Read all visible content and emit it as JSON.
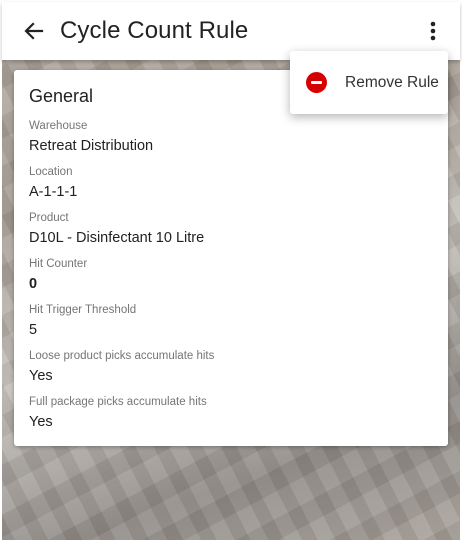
{
  "header": {
    "title": "Cycle Count Rule",
    "back_icon": "arrow-left-icon",
    "more_icon": "more-vertical-icon"
  },
  "menu": {
    "items": [
      {
        "label": "Remove Rule",
        "icon": "remove-circle-icon",
        "icon_color": "#d50000"
      }
    ]
  },
  "card": {
    "title": "General",
    "fields": [
      {
        "label": "Warehouse",
        "value": "Retreat Distribution"
      },
      {
        "label": "Location",
        "value": "A-1-1-1"
      },
      {
        "label": "Product",
        "value": "D10L - Disinfectant 10 Litre"
      },
      {
        "label": "Hit Counter",
        "value": "0"
      },
      {
        "label": "Hit Trigger Threshold",
        "value": "5"
      },
      {
        "label": "Loose product picks accumulate hits",
        "value": "Yes"
      },
      {
        "label": "Full package picks accumulate hits",
        "value": "Yes"
      }
    ]
  },
  "colors": {
    "app_bar": "#ffffff",
    "danger": "#d50000",
    "label_text": "#757575"
  }
}
